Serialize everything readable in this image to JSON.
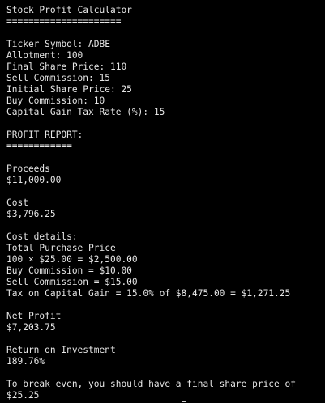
{
  "terminal": {
    "title": "Stock Profit Calculator",
    "title_rule": "=====================",
    "inputs": {
      "ticker": "Ticker Symbol: ADBE",
      "allotment": "Allotment: 100",
      "final_price": "Final Share Price: 110",
      "sell_commission": "Sell Commission: 15",
      "initial_price": "Initial Share Price: 25",
      "buy_commission": "Buy Commission: 10",
      "tax_rate": "Capital Gain Tax Rate (%): 15"
    },
    "report_heading": "PROFIT REPORT:",
    "report_rule": "============",
    "proceeds_label": "Proceeds",
    "proceeds_value": "$11,000.00",
    "cost_label": "Cost",
    "cost_value": "$3,796.25",
    "cost_details_label": "Cost details:",
    "total_purchase_label": "Total Purchase Price",
    "total_purchase_calc": "100 × $25.00 = $2,500.00",
    "buy_commission_line": "Buy Commission = $10.00",
    "sell_commission_line": "Sell Commission = $15.00",
    "tax_line": "Tax on Capital Gain = 15.0% of $8,475.00 = $1,271.25",
    "net_profit_label": "Net Profit",
    "net_profit_value": "$7,203.75",
    "roi_label": "Return on Investment",
    "roi_value": "189.76%",
    "break_even_line": "To break even, you should have a final share price of",
    "break_even_value": "$25.25"
  }
}
